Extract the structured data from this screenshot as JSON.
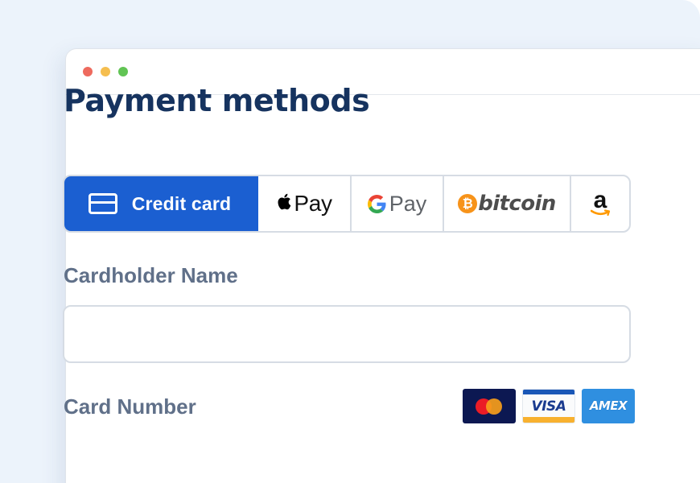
{
  "page": {
    "title": "Payment methods"
  },
  "methods": [
    {
      "id": "credit",
      "label": "Credit card",
      "icon": "credit-card-icon",
      "selected": true
    },
    {
      "id": "apple",
      "label": "Pay",
      "icon": "apple-logo-icon",
      "selected": false
    },
    {
      "id": "google",
      "label": "Pay",
      "icon": "google-g-icon",
      "selected": false
    },
    {
      "id": "bitcoin",
      "label": "bitcoin",
      "icon": "bitcoin-icon",
      "selected": false
    },
    {
      "id": "amazon",
      "label": "a",
      "icon": "amazon-logo-icon",
      "selected": false
    }
  ],
  "form": {
    "cardholder_label": "Cardholder Name",
    "cardholder_value": "",
    "card_number_label": "Card Number"
  },
  "card_brands": {
    "visa": "VISA",
    "amex": "AMEX"
  },
  "colors": {
    "accent": "#1b5fd1",
    "title": "#16335f",
    "label": "#607089",
    "border": "#d6dce4",
    "backdrop": "#ecf3fb"
  }
}
